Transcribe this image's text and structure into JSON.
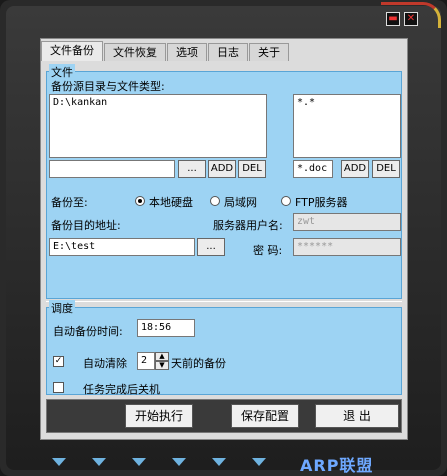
{
  "tabs": [
    "文件备份",
    "文件恢复",
    "选项",
    "日志",
    "关于"
  ],
  "file_group": {
    "title": "文件",
    "source_label": "备份源目录与文件类型:",
    "source_list": [
      "D:\\kankan"
    ],
    "type_list": [
      "*.*"
    ],
    "path_input": "",
    "type_input": "*.doc",
    "browse": "...",
    "add": "ADD",
    "del": "DEL"
  },
  "backup_to": {
    "label": "备份至:",
    "options": [
      "本地硬盘",
      "局域网",
      "FTP服务器"
    ],
    "selected": 0
  },
  "dest": {
    "label": "备份目的地址:",
    "value": "E:\\test",
    "browse": "..."
  },
  "server": {
    "user_label": "服务器用户名:",
    "user_value": "zwt",
    "pwd_label": "密  码:",
    "pwd_value": "******"
  },
  "schedule": {
    "title": "调度",
    "time_label": "自动备份时间:",
    "time_value": "18:56",
    "auto_clear_label": "自动清除",
    "days_value": "2",
    "days_suffix": "天前的备份",
    "shutdown_label": "任务完成后关机"
  },
  "buttons": {
    "start": "开始执行",
    "save": "保存配置",
    "exit": "退  出"
  },
  "brand": "ARP联盟",
  "colors": {
    "accent": "#9dd3f3",
    "frame": "#2a2a2a"
  }
}
